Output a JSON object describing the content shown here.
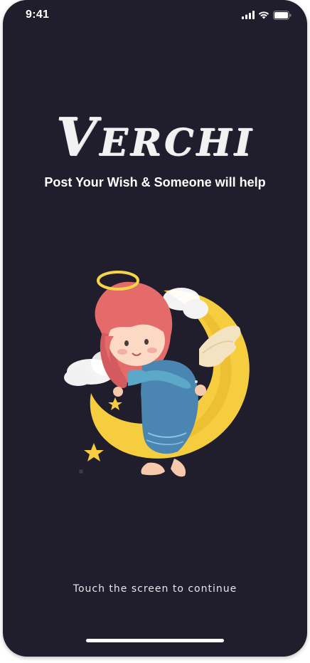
{
  "status_bar": {
    "time": "9:41",
    "icons": [
      "signal-icon",
      "wifi-icon",
      "battery-icon"
    ]
  },
  "app": {
    "logo_text": "Verchi",
    "tagline": "Post Your Wish & Someone will help",
    "illustration": "angel-on-moon-illustration",
    "cta": "Touch the screen to continue"
  },
  "colors": {
    "background": "#201e2c",
    "text": "#ffffff",
    "moon": "#f6cd3f",
    "hair": "#e56b6b",
    "dress": "#4a86b1"
  }
}
